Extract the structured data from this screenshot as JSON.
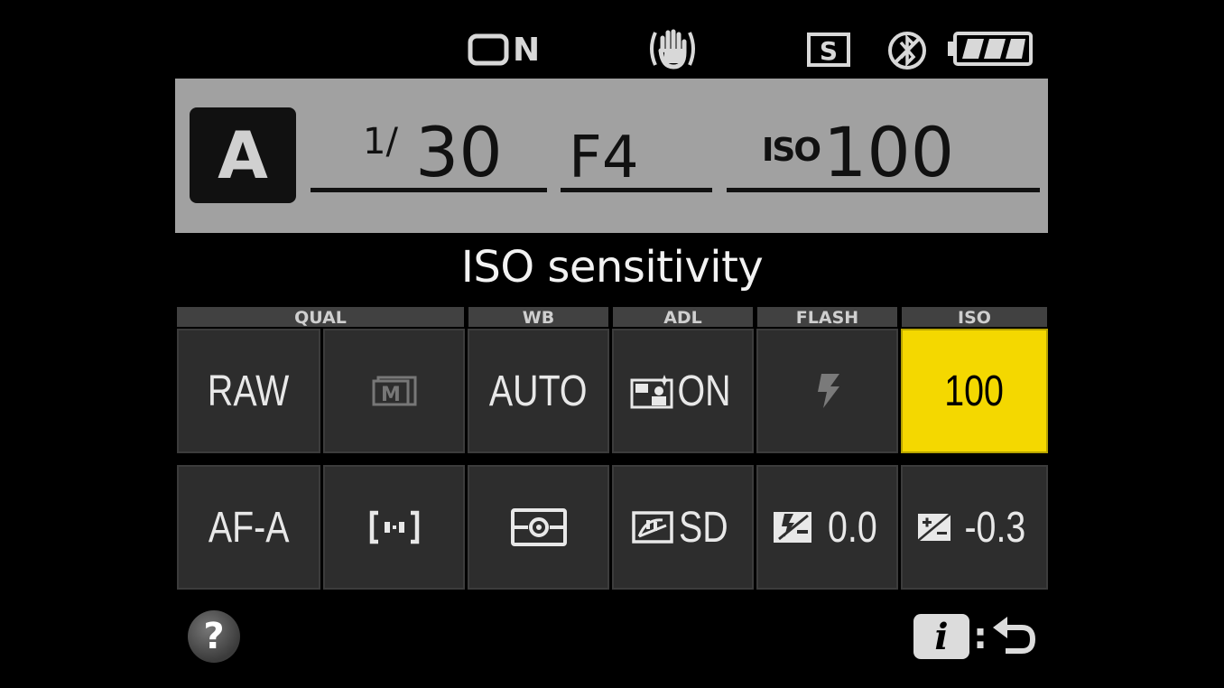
{
  "status_bar": {
    "card_label": "N",
    "icons": [
      "memory-card-icon",
      "vibration-reduction-icon",
      "s-mode-icon",
      "bluetooth-off-icon",
      "battery-icon"
    ]
  },
  "exposure": {
    "mode": "A",
    "shutter_prefix": "1/",
    "shutter_value": "30",
    "aperture": "F4",
    "iso_label": "ISO",
    "iso_value": "100"
  },
  "screen_title": "ISO sensitivity",
  "grid": {
    "headers": {
      "qual": "QUAL",
      "wb": "WB",
      "adl": "ADL",
      "flash": "FLASH",
      "iso": "ISO"
    },
    "row1": {
      "quality": "RAW",
      "wb": "AUTO",
      "adl": "ON",
      "iso": "100"
    },
    "row2": {
      "focus_mode": "AF-A",
      "picture_control": "SD",
      "flash_comp": "0.0",
      "exposure_comp": "-0.3"
    }
  },
  "colors": {
    "accent": "#f4d800",
    "panel": "#a1a1a1",
    "cell": "#2d2d2d"
  },
  "footer": {
    "help_label": "?",
    "info_label": "i",
    "separator": ":"
  }
}
